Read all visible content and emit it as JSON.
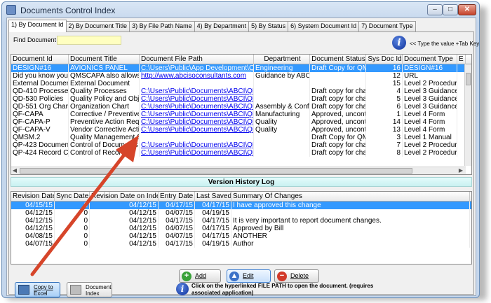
{
  "window": {
    "title": "Documents Control Index",
    "min": "–",
    "max": "□",
    "close": "✕"
  },
  "tabs": [
    {
      "label": "1) By Document Id"
    },
    {
      "label": "2) By Document Title"
    },
    {
      "label": "3) By File Path Name"
    },
    {
      "label": "4) By Department"
    },
    {
      "label": "5) By Status"
    },
    {
      "label": "6) System Document Id"
    },
    {
      "label": "7) Document Type"
    }
  ],
  "find": {
    "label": "Find Document Id:",
    "value": ""
  },
  "hint": "<< Type the value +Tab Key",
  "info_icon": "i",
  "documents": {
    "headers": [
      "Document Id",
      "Document Title",
      "Document File Path",
      "Department",
      "Document Status",
      "Sys Doc Id",
      "Document Type",
      "E"
    ],
    "rows": [
      [
        "DESIGN#16",
        "AVIONICS PANEL",
        "C:\\Users\\Public\\App Development\\QMS",
        "Engineering",
        "Draft Copy for QMS",
        "16",
        "DESIGN#16"
      ],
      [
        "Did you know you c",
        "QMSCAPA also allows y",
        "http://www.abcisoconsultants.com",
        "Guidance by ABCI C",
        "",
        "12",
        "URL"
      ],
      [
        "External Document",
        "External Document",
        "",
        "",
        "",
        "15",
        "Level 2 Procedure"
      ],
      [
        "QD-410 Processes",
        "Quality Processes",
        "C:\\Users\\Public\\Documents\\ABCI\\QMS",
        "",
        "Draft copy for chang",
        "4",
        "Level 3 Guidance D"
      ],
      [
        "QD-530 Policies",
        "Quality Policy and Objec",
        "C:\\Users\\Public\\Documents\\ABCI\\QMS",
        "",
        "Draft copy for chang",
        "5",
        "Level 3 Guidance D"
      ],
      [
        "QD-551 Org Chart",
        "Organization Chart",
        "C:\\Users\\Public\\Documents\\ABCI\\QMS",
        "Assembly & Configu",
        "Draft copy for chang",
        "6",
        "Level 3 Guidance D"
      ],
      [
        "QF-CAPA",
        "Corrective / Preventive A",
        "C:\\Users\\Public\\Documents\\ABCI\\QMS",
        "Manufacturing",
        "Approved, uncontro",
        "1",
        "Level 4 Form"
      ],
      [
        "QF-CAPA-P",
        "Preventive Action Reque",
        "C:\\Users\\Public\\Documents\\ABCI\\QMS",
        "Quality",
        "Approved, uncontro",
        "14",
        "Level 4 Form"
      ],
      [
        "QF-CAPA-V",
        "Vendor Corrective Action",
        "C:\\Users\\Public\\Documents\\ABCI\\QMS",
        "Quality",
        "Approved, uncontro",
        "13",
        "Level 4 Form"
      ],
      [
        "QMSM.2",
        "Quality Management Sys",
        "",
        "",
        "Draft Copy for QMS",
        "3",
        "Level 1 Manual"
      ],
      [
        "QP-423 Document C",
        "Control of Documents",
        "C:\\Users\\Public\\Documents\\ABCI\\QMS",
        "",
        "Draft copy for chang",
        "7",
        "Level 2 Procedure"
      ],
      [
        "QP-424 Record Cor",
        "Control of Records",
        "C:\\Users\\Public\\Documents\\ABCI\\QMS",
        "",
        "Draft copy for chang",
        "8",
        "Level 2 Procedure"
      ]
    ]
  },
  "version_history": {
    "title": "Version History Log",
    "headers": [
      "Revision Date",
      "Sync Date",
      "Revision Date on Index",
      "Entry Date",
      "Last Saved",
      "Summary Of Changes"
    ],
    "rows": [
      [
        "04/15/15",
        "0",
        "04/12/15",
        "04/17/15",
        "04/17/15",
        "I have approved this change"
      ],
      [
        "04/12/15",
        "0",
        "04/12/15",
        "04/07/15",
        "04/19/15",
        ""
      ],
      [
        "04/12/15",
        "0",
        "04/12/15",
        "04/17/15",
        "04/17/15",
        "It is very important to report document changes."
      ],
      [
        "04/12/15",
        "0",
        "04/12/15",
        "04/07/15",
        "04/17/15",
        "Approved by Bill"
      ],
      [
        "04/08/15",
        "0",
        "04/12/15",
        "04/07/15",
        "04/17/15",
        "ANOTHER"
      ],
      [
        "04/07/15",
        "0",
        "04/12/15",
        "04/17/15",
        "04/19/15",
        "Author"
      ]
    ]
  },
  "actions": {
    "add": "Add",
    "edit": "Edit",
    "delete": "Delete"
  },
  "bottom": {
    "copy_excel_line1": "Copy to",
    "copy_excel_line2": "Excel",
    "doc_index_line1": "Document",
    "doc_index_line2": "Index",
    "message": "Click on the hyperlinked FILE PATH to open the document. (requires associated application)"
  },
  "colors": {
    "selection": "#3399ff",
    "link": "#0000ee",
    "arrow": "#d6452a",
    "find_bg": "#ffffc0"
  }
}
